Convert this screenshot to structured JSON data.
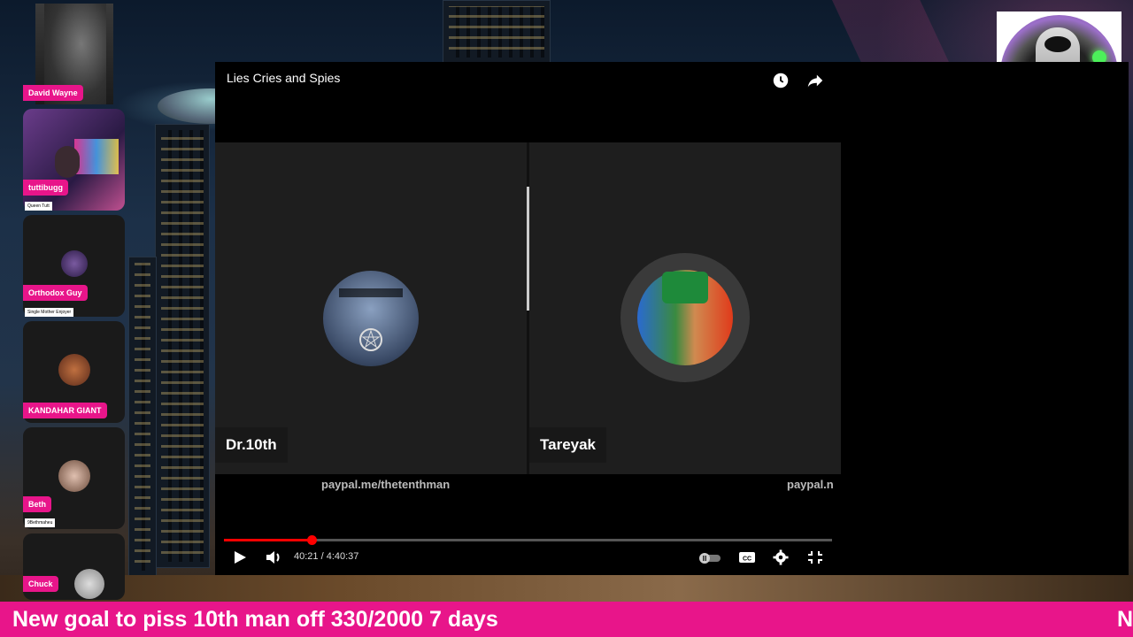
{
  "participants": [
    {
      "name": "David Wayne",
      "sub": ""
    },
    {
      "name": "tuttibugg",
      "sub": "Queen Tutt"
    },
    {
      "name": "Orthodox Guy",
      "sub": "Single Mother Enjoyer"
    },
    {
      "name": "KANDAHAR GIANT",
      "sub": ""
    },
    {
      "name": "Beth",
      "sub": "9Bethmaheu"
    },
    {
      "name": "Chuck",
      "sub": ""
    }
  ],
  "video": {
    "title": "Lies Cries and Spies",
    "left_speaker": "Dr.10th",
    "right_speaker": "Tareyak",
    "paypal_left": "paypal.me/thetenthman",
    "paypal_right": "paypal.n",
    "time": "40:21 / 4:40:37",
    "progress": 0.144,
    "icons": {
      "watch_later": "clock-icon",
      "share": "share-icon",
      "play": "play-icon",
      "volume": "volume-icon",
      "autoplay": "autoplay-toggle-icon",
      "captions": "cc-icon",
      "settings": "gear-icon",
      "exit_fullscreen": "exit-fullscreen-icon"
    }
  },
  "ticker": {
    "text": "New goal to piss 10th man off 330/2000 7 days",
    "text_repeat": "N"
  },
  "colors": {
    "accent": "#e8158a",
    "progress": "#ff0000"
  }
}
